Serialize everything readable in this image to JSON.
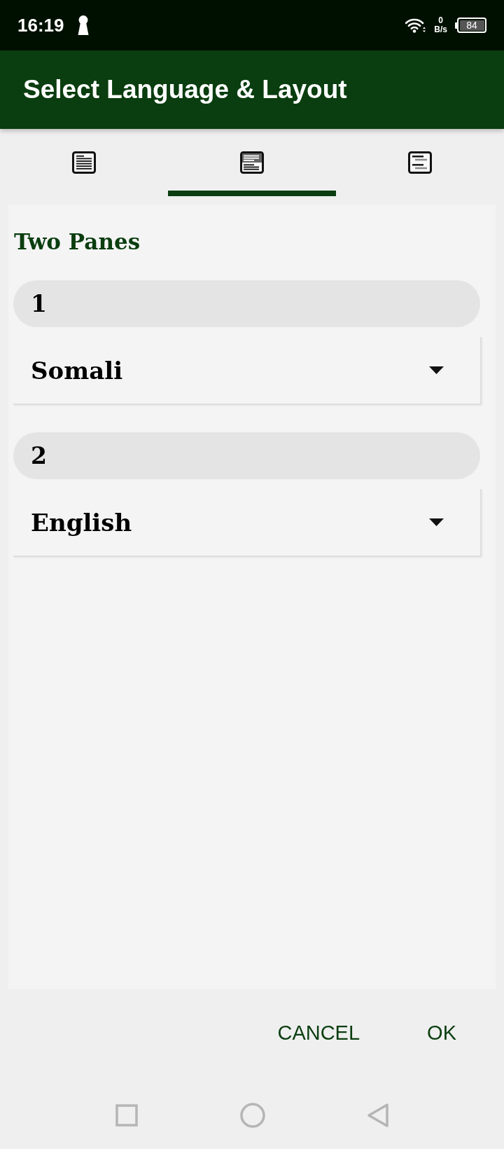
{
  "status_bar": {
    "time": "16:19",
    "net_speed_value": "0",
    "net_speed_unit": "B/s",
    "battery": "84"
  },
  "app_bar": {
    "title": "Select Language & Layout"
  },
  "tabs": [
    {
      "kind": "single",
      "selected": false
    },
    {
      "kind": "stacked",
      "selected": true
    },
    {
      "kind": "interlinear",
      "selected": false
    }
  ],
  "panel": {
    "heading": "Two Panes",
    "panes": [
      {
        "number": "1",
        "language": "Somali"
      },
      {
        "number": "2",
        "language": "English"
      }
    ]
  },
  "buttons": [
    "CANCEL",
    "OK"
  ]
}
